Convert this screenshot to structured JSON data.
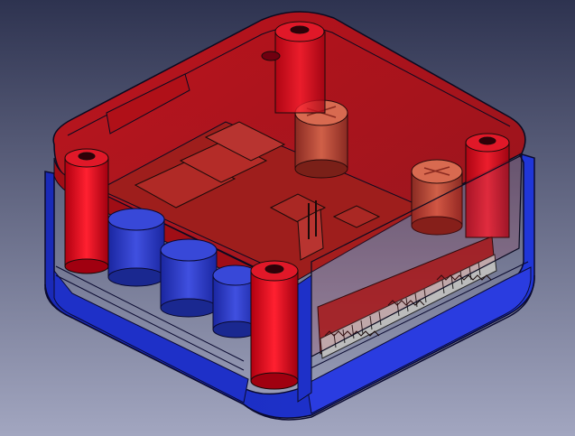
{
  "viewport": {
    "background_top": "#2e3350",
    "background_bottom": "#a2a6c0"
  },
  "model": {
    "lid_color": "#e0141c",
    "base_color": "#1d2fd0",
    "pcb_color": "#9e1e1c",
    "capacitor_color": "#c04030",
    "capacitor_blue_color": "#2838c8",
    "connector_color": "#bcbcbc",
    "edge_color": "#0a0a20"
  }
}
